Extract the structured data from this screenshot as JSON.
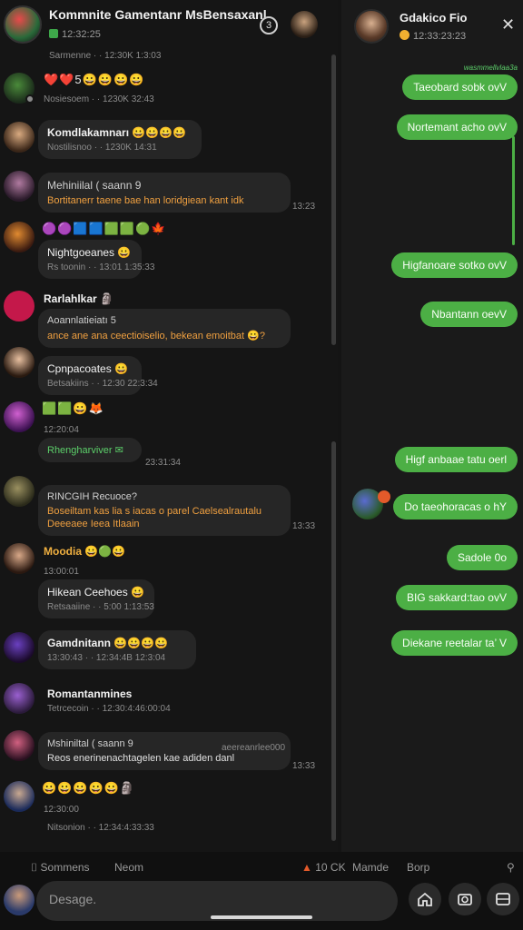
{
  "header": {
    "title": "Kommnite Gamentanr MsBensaxanl",
    "subtitle": "12:32:25",
    "badge": "3"
  },
  "top_strip": "Sarmenne · · 12:30K  1:3:03",
  "messages": [
    {
      "emoji": "❤️❤️5😀😀😀😀",
      "meta": "Nosiesoem · · 1230K  32:43"
    },
    {
      "name": "Komdlakamnarı 😀😀😀😀",
      "meta": "Nostilisnoo · · 1230K  14:31"
    },
    {
      "name": "Mehiniilal ( saann 9",
      "text": "Bortitanerr taene bae han loridgiean kant idk",
      "time": "13:23"
    },
    {
      "emoji": "🟣🟣🟦🟦🟩🟩🟢🍁",
      "name": "Nightgoeanes 😀",
      "meta": "Rs toonin · · 13:01  1:35:33"
    },
    {
      "name": "Rarlahlkar 🗿",
      "sub": "Aoannlatieiatı 5",
      "text": "ance ane ana ceectioiselio, bekean emoitbat 😀?"
    },
    {
      "name": "Cpnpacoates 😀",
      "meta": "Betsakiins · · 12:30  22:3:34"
    },
    {
      "emoji": "🟩🟩😀🦊",
      "meta": "12:20:04",
      "name": "Rhengharviver ✉",
      "time": "23:31:34"
    },
    {
      "name": "RINCGIH Recuoce?",
      "text": "Boseiltam kas lia s iacas o parel Caelsealrautalu",
      "text2": "Deeeaee Ieea Itlaain",
      "time": "13:33"
    },
    {
      "name": "Moodia 😀🟢😀",
      "meta": "13:00:01",
      "text": "Hikean Ceehoes 😀",
      "meta2": "Retsaaiine · · 5:00  1:13:53"
    },
    {
      "name": "Gamdnitann 😀😀😀😀",
      "meta": "13:30:43 · · 12:34:4B 12:3:04"
    },
    {
      "name": "Romantanmines",
      "meta": "Tetrcecoin · · 12:30:4:46:00:04"
    },
    {
      "name": "Mshiniltal ( saann 9",
      "text": "Reos enerinenachtagelen kae adiden danl",
      "sub": "aeereanrlee000",
      "time": "13:33"
    },
    {
      "emoji": "😀😀😀😀😀🗿",
      "meta": "12:30:00",
      "meta2": "Nitsonion · · 12:34:4:33:33"
    }
  ],
  "right": {
    "name": "Gdakico Fio",
    "sub": "12:33:23:23",
    "label": "wasmmellvlaa3a",
    "bubbles": [
      "Taeobard sobk ovV",
      "Nortemant acho ovV",
      "Higfanoare sotko ovV",
      "Nbantann oevV",
      "Higf anbaae tatu oerl",
      "Do taeohoracas o hY",
      "Sadole 0o",
      "BIG sakkard:tao ovV",
      "Diekane reetalar ta’ V"
    ]
  },
  "tabs": {
    "t1": "⌷ Sommens",
    "t2": "Neom",
    "t3": "10 CK",
    "t4": "Mamde",
    "t5": "Borp"
  },
  "composer": {
    "placeholder": "Desage."
  },
  "colors": {
    "accent": "#4caf45",
    "background": "#151515"
  }
}
